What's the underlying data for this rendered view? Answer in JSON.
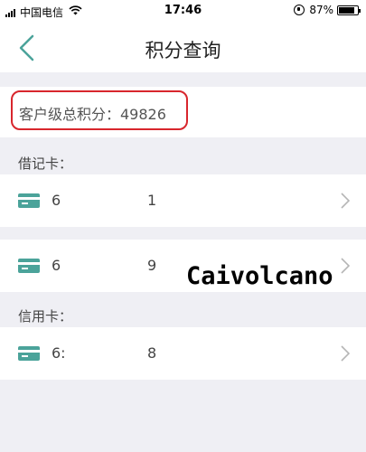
{
  "status_bar": {
    "carrier": "中国电信",
    "time": "17:46",
    "battery": "87%",
    "battery_level": 0.87
  },
  "header": {
    "title": "积分查询",
    "back_icon": "chevron-left-icon"
  },
  "score": {
    "text": "客户级总积分：49826"
  },
  "debit_section": {
    "label": "借记卡：",
    "cards": [
      {
        "num_a": "6",
        "num_b": "1"
      },
      {
        "num_a": "6",
        "num_b": "9"
      }
    ]
  },
  "credit_section": {
    "label": "信用卡：",
    "cards": [
      {
        "num_a": "6:",
        "num_b": "8"
      }
    ]
  },
  "watermark": "Caivolcano",
  "colors": {
    "accent": "#4ba39a",
    "highlight_border": "#d8262d",
    "background": "#efeff4"
  }
}
